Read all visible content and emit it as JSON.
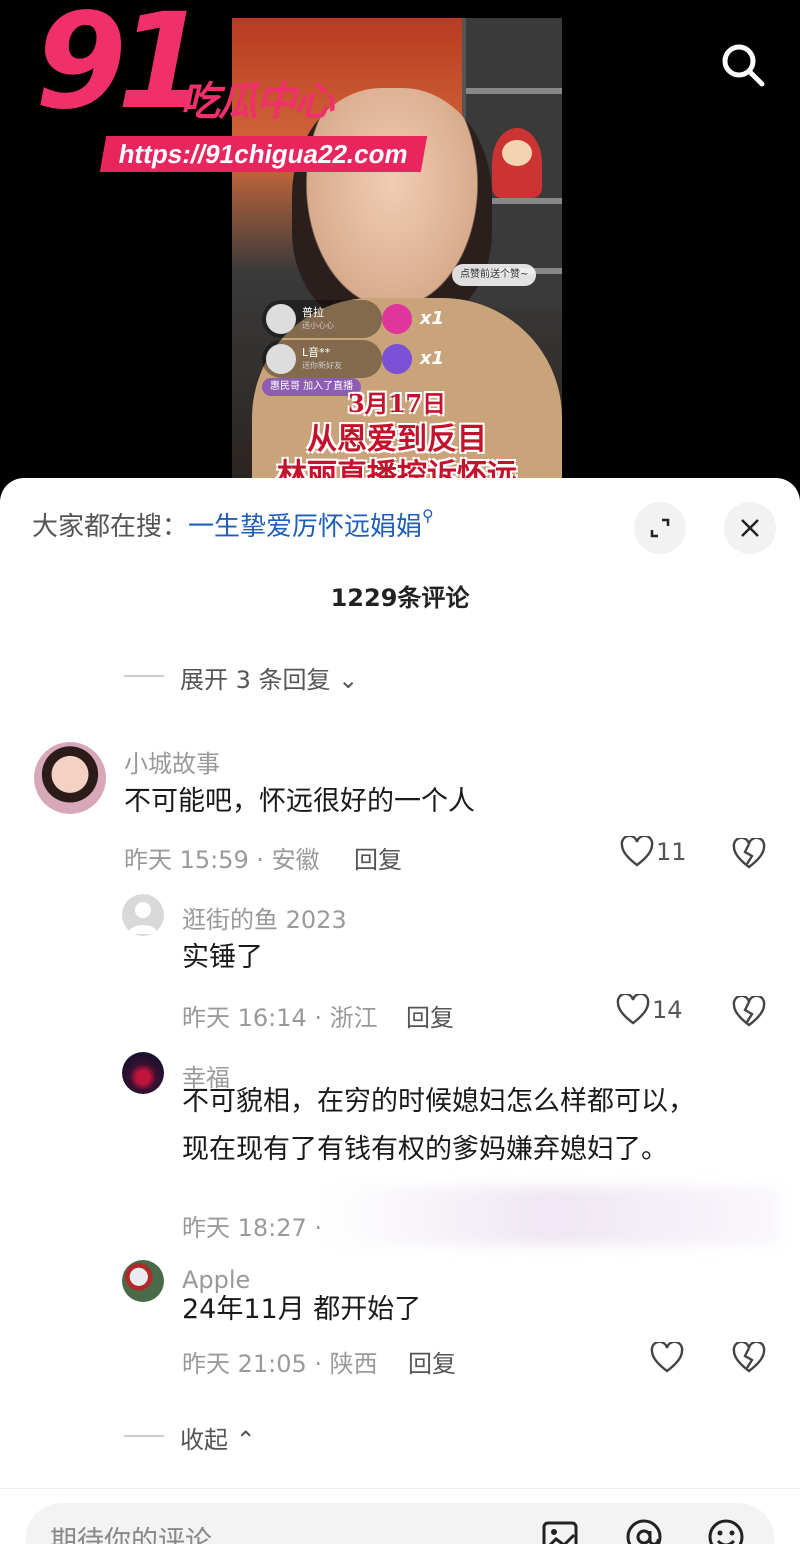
{
  "watermark": {
    "number": "91",
    "name": "吃瓜中心",
    "url": "https://91chigua22.com"
  },
  "video": {
    "sticker_tag": "点赞前送个赞~",
    "gifts": [
      {
        "name": "普拉",
        "sub": "送小心心",
        "count": "x1"
      },
      {
        "name": "L音**",
        "sub": "送你新好友",
        "count": "x1"
      }
    ],
    "join_notice": "惠民哥 加入了直播",
    "caption_date": "3月17日",
    "caption_line1": "从恩爱到反目",
    "caption_line2": "林丽直播控诉怀远"
  },
  "sheet": {
    "hot_search_prefix": "大家都在搜：",
    "hot_search_keyword": "一生挚爱厉怀远娟娟",
    "comment_count": "1229条评论",
    "expand_replies": "展开 3 条回复",
    "collapse": "收起"
  },
  "comments": [
    {
      "user": "小城故事",
      "text": "不可能吧，怀远很好的一个人",
      "meta": "昨天 15:59 · 安徽",
      "reply": "回复",
      "likes": "11"
    },
    {
      "user": "逛街的鱼 2023",
      "text": "实锤了",
      "meta": "昨天 16:14 · 浙江",
      "reply": "回复",
      "likes": "14"
    },
    {
      "user": "幸福",
      "text_line1": "不可貌相，在穷的时候媳妇怎么样都可以，",
      "text_line2": "现在现有了有钱有权的爹妈嫌弃媳妇了。",
      "meta": "昨天 18:27 ·"
    },
    {
      "user": "Apple",
      "text": "24年11月 都开始了",
      "meta": "昨天 21:05 · 陕西",
      "reply": "回复",
      "likes": ""
    }
  ],
  "input": {
    "placeholder": "期待你的评论"
  },
  "colors": {
    "brand": "#f0306a",
    "link": "#1f5fb8",
    "caption": "#c3122c"
  }
}
